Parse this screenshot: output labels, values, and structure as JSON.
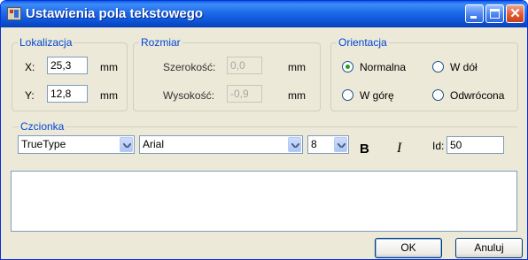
{
  "window": {
    "title": "Ustawienia pola tekstowego"
  },
  "lokalizacja": {
    "title": "Lokalizacja",
    "x_label": "X:",
    "x_value": "25,3",
    "y_label": "Y:",
    "y_value": "12,8",
    "unit": "mm"
  },
  "rozmiar": {
    "title": "Rozmiar",
    "width_label": "Szerokość:",
    "width_value": "0,0",
    "height_label": "Wysokość:",
    "height_value": "-0,9",
    "unit": "mm"
  },
  "orientacja": {
    "title": "Orientacja",
    "options": [
      "Normalna",
      "W dół",
      "W górę",
      "Odwrócona"
    ],
    "selected": "Normalna"
  },
  "czcionka": {
    "title": "Czcionka",
    "type_value": "TrueType",
    "font_value": "Arial",
    "size_value": "8",
    "bold_label": "B",
    "italic_label": "I",
    "id_label": "Id:",
    "id_value": "50"
  },
  "buttons": {
    "ok": "OK",
    "cancel": "Anuluj"
  },
  "colors": {
    "group_label": "#0046d5",
    "titlebar": "#0a5ee6",
    "radio_selected": "#21a121"
  }
}
